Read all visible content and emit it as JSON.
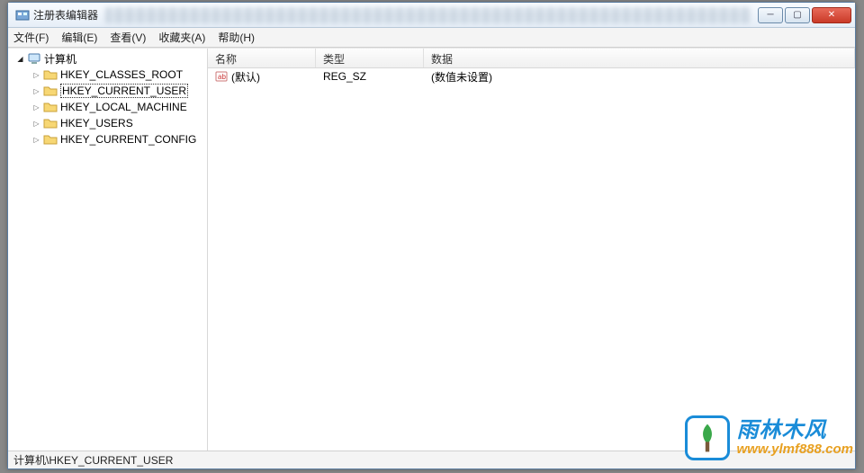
{
  "window": {
    "title": "注册表编辑器"
  },
  "menu": {
    "file": "文件(F)",
    "edit": "编辑(E)",
    "view": "查看(V)",
    "favorites": "收藏夹(A)",
    "help": "帮助(H)"
  },
  "tree": {
    "root": "计算机",
    "items": [
      "HKEY_CLASSES_ROOT",
      "HKEY_CURRENT_USER",
      "HKEY_LOCAL_MACHINE",
      "HKEY_USERS",
      "HKEY_CURRENT_CONFIG"
    ],
    "selected_index": 1
  },
  "list": {
    "columns": {
      "name": "名称",
      "type": "类型",
      "data": "数据"
    },
    "rows": [
      {
        "name": "(默认)",
        "type": "REG_SZ",
        "data": "(数值未设置)"
      }
    ]
  },
  "statusbar": {
    "path": "计算机\\HKEY_CURRENT_USER"
  },
  "watermark": {
    "brand": "雨林木风",
    "url": "www.ylmf888.com"
  }
}
